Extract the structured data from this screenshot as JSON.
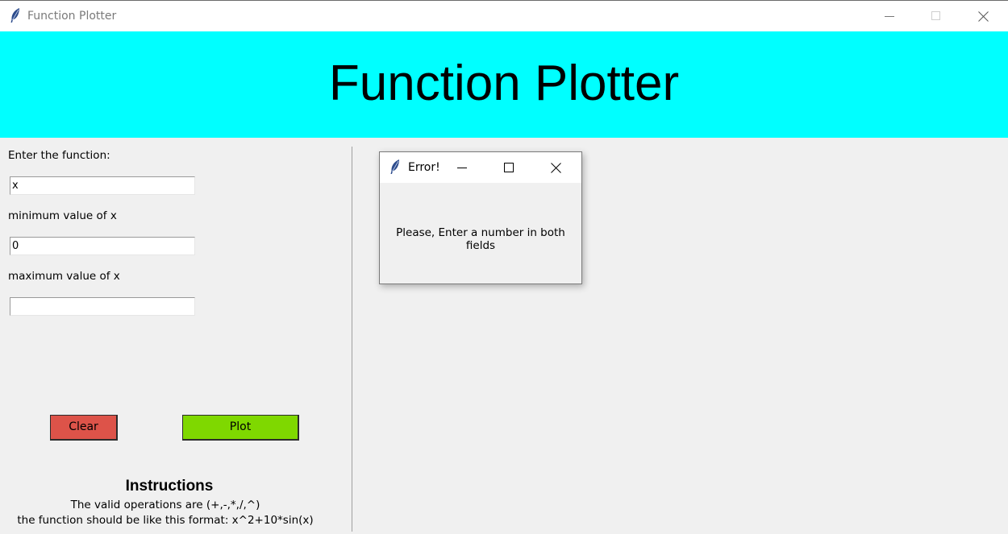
{
  "window": {
    "title": "Function Plotter",
    "icon": "feather-icon"
  },
  "header": {
    "title": "Function Plotter",
    "background": "#00ffff"
  },
  "form": {
    "function_label": "Enter the function:",
    "function_value": "x",
    "min_label": "minimum value of x",
    "min_value": "0",
    "max_label": "maximum value of x",
    "max_value": ""
  },
  "buttons": {
    "clear_label": "Clear",
    "clear_color": "#dd5349",
    "plot_label": "Plot",
    "plot_color": "#7fd800"
  },
  "instructions": {
    "title": "Instructions",
    "line1": "The valid operations are (+,-,*,/,^)",
    "line2": "the function should be like this format: x^2+10*sin(x)"
  },
  "dialog": {
    "title": "Error!",
    "message": "Please, Enter a number in both fields"
  }
}
